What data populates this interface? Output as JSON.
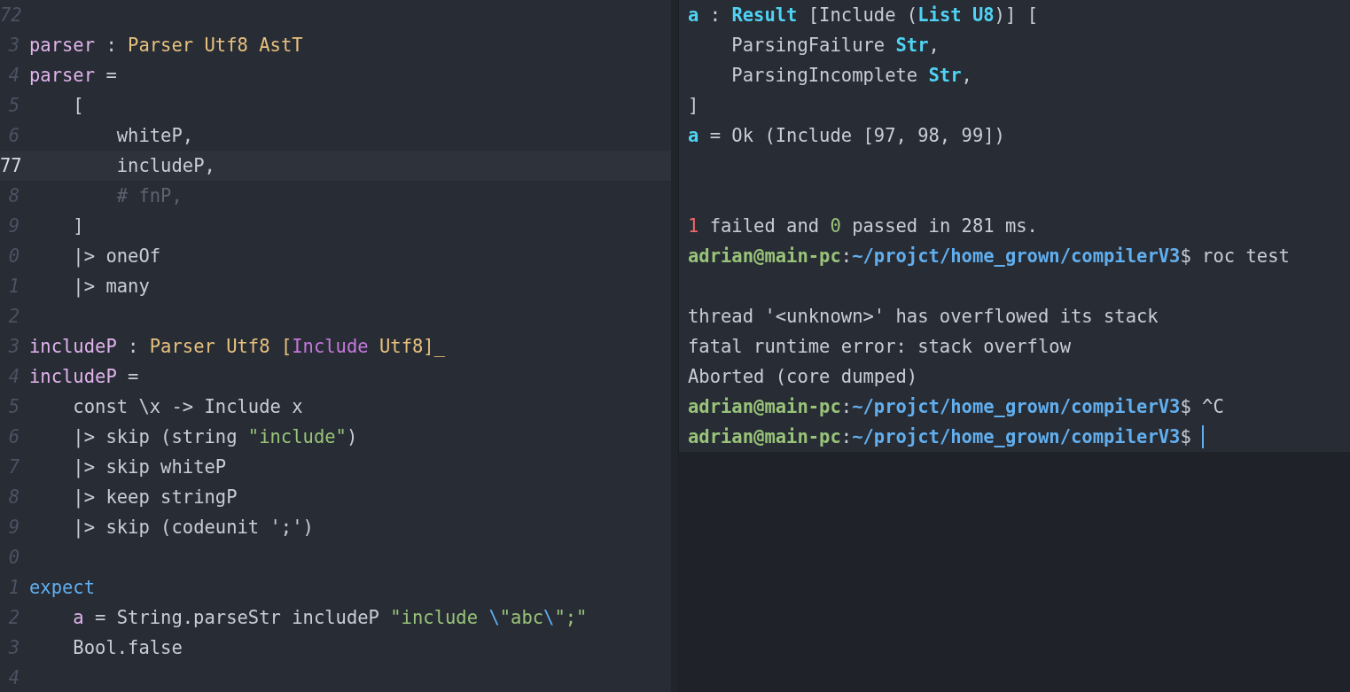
{
  "editor": {
    "lines": [
      {
        "number": "72",
        "current": false
      },
      {
        "number": "3",
        "current": false,
        "tokens": [
          {
            "kind": "def",
            "text": "parser"
          },
          {
            "kind": "plain",
            "text": " : "
          },
          {
            "kind": "type",
            "text": "Parser Utf8 AstT"
          }
        ]
      },
      {
        "number": "4",
        "current": false,
        "tokens": [
          {
            "kind": "def",
            "text": "parser"
          },
          {
            "kind": "plain",
            "text": " ="
          }
        ]
      },
      {
        "number": "5",
        "current": false,
        "tokens": [
          {
            "kind": "plain",
            "text": "    ["
          }
        ]
      },
      {
        "number": "6",
        "current": false,
        "tokens": [
          {
            "kind": "plain",
            "text": "        whiteP,"
          }
        ]
      },
      {
        "number": "77",
        "current": true,
        "tokens": [
          {
            "kind": "plain",
            "text": "        includeP,"
          }
        ]
      },
      {
        "number": "8",
        "current": false,
        "tokens": [
          {
            "kind": "comment",
            "text": "        # fnP,"
          }
        ]
      },
      {
        "number": "9",
        "current": false,
        "tokens": [
          {
            "kind": "plain",
            "text": "    ]"
          }
        ]
      },
      {
        "number": "0",
        "current": false,
        "tokens": [
          {
            "kind": "plain",
            "text": "    |> oneOf"
          }
        ]
      },
      {
        "number": "1",
        "current": false,
        "tokens": [
          {
            "kind": "plain",
            "text": "    |> many"
          }
        ]
      },
      {
        "number": "2",
        "current": false
      },
      {
        "number": "3",
        "current": false,
        "tokens": [
          {
            "kind": "def",
            "text": "includeP"
          },
          {
            "kind": "plain",
            "text": " : "
          },
          {
            "kind": "type",
            "text": "Parser Utf8 ["
          },
          {
            "kind": "tag",
            "text": "Include"
          },
          {
            "kind": "type",
            "text": " Utf8]_"
          }
        ]
      },
      {
        "number": "4",
        "current": false,
        "tokens": [
          {
            "kind": "def",
            "text": "includeP"
          },
          {
            "kind": "plain",
            "text": " ="
          }
        ]
      },
      {
        "number": "5",
        "current": false,
        "tokens": [
          {
            "kind": "plain",
            "text": "    const \\x -> Include x"
          }
        ]
      },
      {
        "number": "6",
        "current": false,
        "tokens": [
          {
            "kind": "plain",
            "text": "    |> skip (string "
          },
          {
            "kind": "string",
            "text": "\"include\""
          },
          {
            "kind": "plain",
            "text": ")"
          }
        ]
      },
      {
        "number": "7",
        "current": false,
        "tokens": [
          {
            "kind": "plain",
            "text": "    |> skip whiteP"
          }
        ]
      },
      {
        "number": "8",
        "current": false,
        "tokens": [
          {
            "kind": "plain",
            "text": "    |> keep stringP"
          }
        ]
      },
      {
        "number": "9",
        "current": false,
        "tokens": [
          {
            "kind": "plain",
            "text": "    |> skip (codeunit ';')"
          }
        ]
      },
      {
        "number": "0",
        "current": false
      },
      {
        "number": "1",
        "current": false,
        "tokens": [
          {
            "kind": "keyword",
            "text": "expect"
          }
        ]
      },
      {
        "number": "2",
        "current": false,
        "tokens": [
          {
            "kind": "def",
            "text": "a",
            "indented": true
          },
          {
            "kind": "plain",
            "text": " = String.parseStr includeP "
          },
          {
            "kind": "string",
            "text": "\"include "
          },
          {
            "kind": "escape",
            "text": "\\"
          },
          {
            "kind": "string",
            "text": "\"abc"
          },
          {
            "kind": "escape",
            "text": "\\"
          },
          {
            "kind": "string",
            "text": "\";\""
          }
        ]
      },
      {
        "number": "3",
        "current": false,
        "tokens": [
          {
            "kind": "plain",
            "text": "    Bool.false"
          }
        ]
      },
      {
        "number": "4",
        "current": false
      }
    ]
  },
  "terminal": {
    "lines": [
      {
        "cursor": false,
        "tokens": [
          {
            "kind": "bold",
            "text": "a"
          },
          {
            "kind": "plain",
            "text": " : "
          },
          {
            "kind": "bold",
            "text": "Result"
          },
          {
            "kind": "plain",
            "text": " [Include ("
          },
          {
            "kind": "bold",
            "text": "List U8"
          },
          {
            "kind": "plain",
            "text": ")] ["
          }
        ]
      },
      {
        "cursor": false,
        "tokens": [
          {
            "kind": "plain",
            "text": "    ParsingFailure "
          },
          {
            "kind": "bold",
            "text": "Str"
          },
          {
            "kind": "plain",
            "text": ","
          }
        ]
      },
      {
        "cursor": false,
        "tokens": [
          {
            "kind": "plain",
            "text": "    ParsingIncomplete "
          },
          {
            "kind": "bold",
            "text": "Str"
          },
          {
            "kind": "plain",
            "text": ","
          }
        ]
      },
      {
        "cursor": false,
        "tokens": [
          {
            "kind": "plain",
            "text": "]"
          }
        ]
      },
      {
        "cursor": false,
        "tokens": [
          {
            "kind": "bold",
            "text": "a"
          },
          {
            "kind": "plain",
            "text": " = Ok (Include [97, 98, 99])"
          }
        ]
      },
      {
        "cursor": false
      },
      {
        "cursor": false
      },
      {
        "cursor": false,
        "tokens": [
          {
            "kind": "fail",
            "text": "1"
          },
          {
            "kind": "plain",
            "text": " failed and "
          },
          {
            "kind": "pass",
            "text": "0"
          },
          {
            "kind": "plain",
            "text": " passed in 281 ms."
          }
        ]
      },
      {
        "cursor": false,
        "tokens": [
          {
            "kind": "user",
            "text": "adrian@main-pc"
          },
          {
            "kind": "plain",
            "text": ":"
          },
          {
            "kind": "path",
            "text": "~/projct/home_grown/compilerV3"
          },
          {
            "kind": "plain",
            "text": "$ roc test"
          }
        ]
      },
      {
        "cursor": false
      },
      {
        "cursor": false,
        "tokens": [
          {
            "kind": "plain",
            "text": "thread '<unknown>' has overflowed its stack"
          }
        ]
      },
      {
        "cursor": false,
        "tokens": [
          {
            "kind": "plain",
            "text": "fatal runtime error: stack overflow"
          }
        ]
      },
      {
        "cursor": false,
        "tokens": [
          {
            "kind": "plain",
            "text": "Aborted (core dumped)"
          }
        ]
      },
      {
        "cursor": false,
        "tokens": [
          {
            "kind": "user",
            "text": "adrian@main-pc"
          },
          {
            "kind": "plain",
            "text": ":"
          },
          {
            "kind": "path",
            "text": "~/projct/home_grown/compilerV3"
          },
          {
            "kind": "plain",
            "text": "$ ^C"
          }
        ]
      },
      {
        "cursor": true,
        "tokens": [
          {
            "kind": "user",
            "text": "adrian@main-pc"
          },
          {
            "kind": "plain",
            "text": ":"
          },
          {
            "kind": "path",
            "text": "~/projct/home_grown/compilerV3"
          },
          {
            "kind": "plain",
            "text": "$ "
          }
        ]
      }
    ]
  }
}
